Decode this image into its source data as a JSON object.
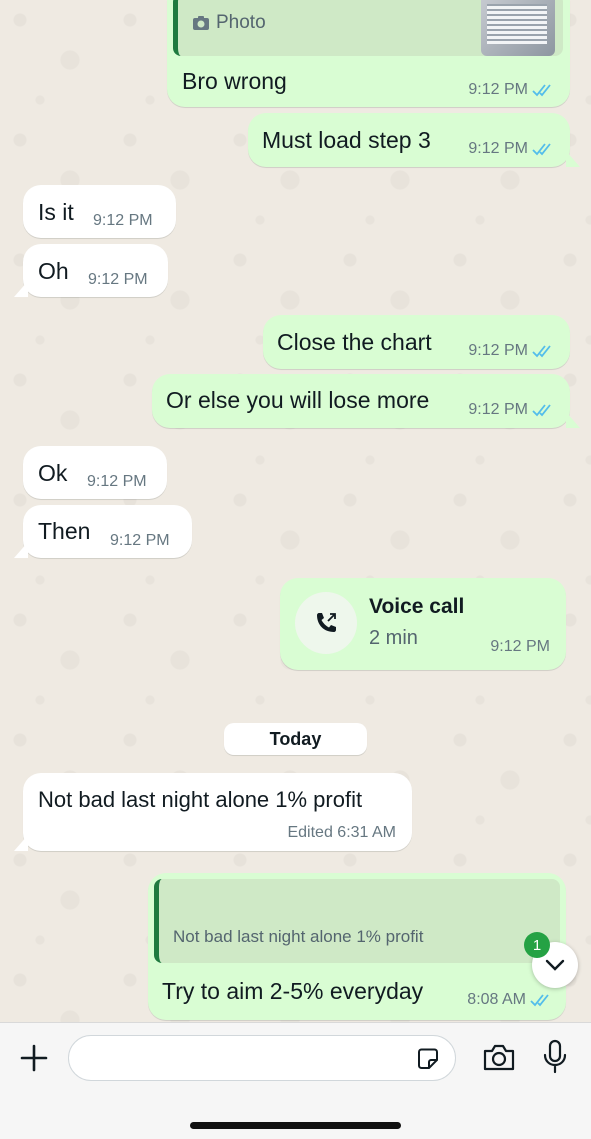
{
  "messages": {
    "m1": {
      "quote_label": "Photo",
      "text": "Bro wrong",
      "time": "9:12 PM"
    },
    "m2": {
      "text": "Must load step 3",
      "time": "9:12 PM"
    },
    "m3": {
      "text": "Is it",
      "time": "9:12 PM"
    },
    "m4": {
      "text": "Oh",
      "time": "9:12 PM"
    },
    "m5": {
      "text": "Close the chart",
      "time": "9:12 PM"
    },
    "m6": {
      "text": "Or else you will lose more",
      "time": "9:12 PM"
    },
    "m7": {
      "text": "Ok",
      "time": "9:12 PM"
    },
    "m8": {
      "text": "Then",
      "time": "9:12 PM"
    },
    "call": {
      "title": "Voice call",
      "duration": "2 min",
      "time": "9:12 PM"
    },
    "m9": {
      "text": "Not bad last night alone 1% profit",
      "time": "Edited 6:31 AM"
    },
    "m10": {
      "quote_text": "Not bad last night alone 1% profit",
      "text": "Try to aim 2-5% everyday",
      "time": "8:08 AM"
    }
  },
  "date_chip": "Today",
  "unread_count": "1",
  "colors": {
    "outgoing": "#d9fdd3",
    "incoming": "#ffffff",
    "read_ticks": "#53bdeb",
    "accent": "#25a244"
  }
}
